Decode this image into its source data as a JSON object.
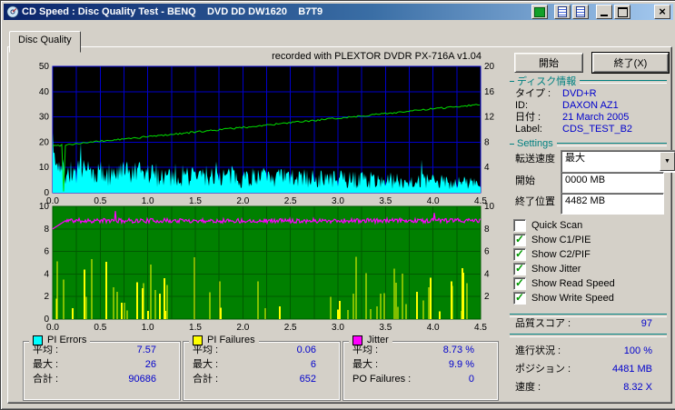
{
  "window": {
    "title": "CD Speed : Disc Quality Test - BENQ    DVD DD DW1620    B7T9",
    "close_glyph": "×"
  },
  "tab": {
    "label": "Disc Quality"
  },
  "recorded_with": "recorded with PLEXTOR DVDR    PX-716A    v1.04",
  "icons": {
    "dropdown": "▼"
  },
  "buttons": {
    "start": "開始",
    "exit": "終了(X)"
  },
  "disc_info": {
    "header": "ディスク情報",
    "rows": [
      {
        "label": "タイプ :",
        "value": "DVD+R"
      },
      {
        "label": "ID:",
        "value": "DAXON AZ1"
      },
      {
        "label": "日付 :",
        "value": "21 March 2005"
      },
      {
        "label": "Label:",
        "value": "CDS_TEST_B2"
      }
    ]
  },
  "settings": {
    "header": "Settings",
    "speed_label": "転送速度",
    "speed_value": "最大",
    "start_label": "開始",
    "start_value": "0000 MB",
    "end_label": "終了位置",
    "end_value": "4482 MB",
    "checkboxes": [
      {
        "label": "Quick Scan",
        "checked": false
      },
      {
        "label": "Show C1/PIE",
        "checked": true
      },
      {
        "label": "Show C2/PIF",
        "checked": true
      },
      {
        "label": "Show Jitter",
        "checked": true
      },
      {
        "label": "Show Read Speed",
        "checked": true
      },
      {
        "label": "Show Write Speed",
        "checked": true
      }
    ]
  },
  "status": {
    "quality_label": "品質スコア :",
    "quality_value": "97",
    "progress_label": "進行状況 :",
    "progress_value": "100 %",
    "position_label": "ポジション :",
    "position_value": "4481 MB",
    "speed_label": "速度 :",
    "speed_value": "8.32 X"
  },
  "stats": [
    {
      "legend": "PI Errors",
      "color": "#00ffff",
      "rows": [
        [
          "平均 :",
          "7.57"
        ],
        [
          "最大 :",
          "26"
        ],
        [
          "合計 :",
          "90686"
        ]
      ]
    },
    {
      "legend": "PI Failures",
      "color": "#ffff00",
      "rows": [
        [
          "平均 :",
          "0.06"
        ],
        [
          "最大 :",
          "6"
        ],
        [
          "合計 :",
          "652"
        ]
      ]
    },
    {
      "legend": "Jitter",
      "color": "#ff00ff",
      "rows": [
        [
          "平均 :",
          "8.73 %"
        ],
        [
          "最大 :",
          "9.9 %"
        ],
        [
          "PO Failures :",
          "0"
        ]
      ]
    }
  ],
  "chart_data": [
    {
      "type": "area",
      "name": "PI Errors / Write Speed",
      "x_max": 4.5,
      "x_ticks": [
        "0.0",
        "0.5",
        "1.0",
        "1.5",
        "2.0",
        "2.5",
        "3.0",
        "3.5",
        "4.0",
        "4.5"
      ],
      "y_left": {
        "max": 50,
        "grid_step": 10,
        "ticks": [
          0,
          10,
          20,
          30,
          40,
          50
        ]
      },
      "y_right": {
        "max": 20,
        "ticks": [
          4,
          8,
          12,
          16,
          20
        ]
      },
      "bg": "#000000",
      "grid": "#0000cc",
      "series": [
        {
          "name": "PI Errors",
          "style": "noise-area",
          "color": "#00ffff",
          "avg": 7.57,
          "max": 26,
          "seed": 7
        },
        {
          "name": "Write Speed",
          "style": "trend-line",
          "color": "#00dd00",
          "axis": "right",
          "start": 7.4,
          "end": 14.0,
          "dip_x": 0.12,
          "seed": 99
        }
      ]
    },
    {
      "type": "bar",
      "name": "PI Failures / Jitter",
      "x_max": 4.5,
      "x_ticks": [
        "0.0",
        "0.5",
        "1.0",
        "1.5",
        "2.0",
        "2.5",
        "3.0",
        "3.5",
        "4.0",
        "4.5"
      ],
      "y_left": {
        "max": 10,
        "grid_step": 2,
        "ticks": [
          0,
          2,
          4,
          6,
          8,
          10
        ]
      },
      "y_right": {
        "max": 10,
        "ticks": [
          2,
          4,
          6,
          8,
          10
        ]
      },
      "bg": "#008000",
      "grid": "#005a00",
      "series": [
        {
          "name": "PI Failures",
          "style": "spikes",
          "color": "#ffff00",
          "avg": 0.06,
          "max": 6,
          "seed": 31,
          "dense": [
            [
              0.0,
              0.28
            ],
            [
              0.61,
              1.0
            ]
          ]
        },
        {
          "name": "Jitter",
          "style": "noisy-line",
          "color": "#ff00ff",
          "avg": 8.73,
          "max": 9.9,
          "start": 8.0,
          "seed": 11
        }
      ]
    }
  ]
}
